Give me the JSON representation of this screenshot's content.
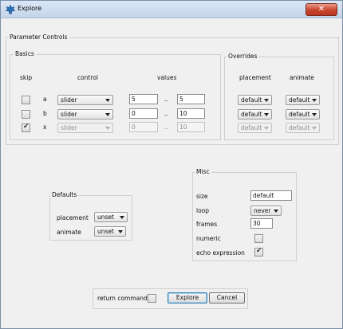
{
  "window": {
    "title": "Explore",
    "close_icon": "✕"
  },
  "parameter_controls": {
    "title": "Parameter Controls",
    "basics": {
      "title": "Basics",
      "headers": {
        "skip": "skip",
        "control": "control",
        "values": "values"
      },
      "rows": [
        {
          "skip": false,
          "name": "a",
          "control": "slider",
          "from": "5",
          "sep": "..",
          "to": "5",
          "disabled": false
        },
        {
          "skip": false,
          "name": "b",
          "control": "slider",
          "from": "0",
          "sep": "..",
          "to": "10",
          "disabled": false
        },
        {
          "skip": true,
          "name": "x",
          "control": "slider",
          "from": "0",
          "sep": "..",
          "to": "10",
          "disabled": true
        }
      ]
    },
    "overrides": {
      "title": "Overrides",
      "headers": {
        "placement": "placement",
        "animate": "animate"
      },
      "rows": [
        {
          "placement": "default",
          "animate": "default"
        },
        {
          "placement": "default",
          "animate": "default"
        },
        {
          "placement": "default",
          "animate": "default"
        }
      ]
    }
  },
  "defaults": {
    "title": "Defaults",
    "placement_label": "placement",
    "placement_value": "unset",
    "animate_label": "animate",
    "animate_value": "unset"
  },
  "misc": {
    "title": "Misc",
    "size_label": "size",
    "size_value": "default",
    "loop_label": "loop",
    "loop_value": "never",
    "frames_label": "frames",
    "frames_value": "30",
    "numeric_label": "numeric",
    "numeric_checked": false,
    "echo_label": "echo expression",
    "echo_checked": true
  },
  "footer": {
    "return_command_label": "return command",
    "return_command_checked": false,
    "explore_button": "Explore",
    "cancel_button": "Cancel"
  },
  "colors": {
    "title_bar": "#c4d5ea",
    "close_button": "#c9442c",
    "window_bg": "#f0f0f0"
  }
}
